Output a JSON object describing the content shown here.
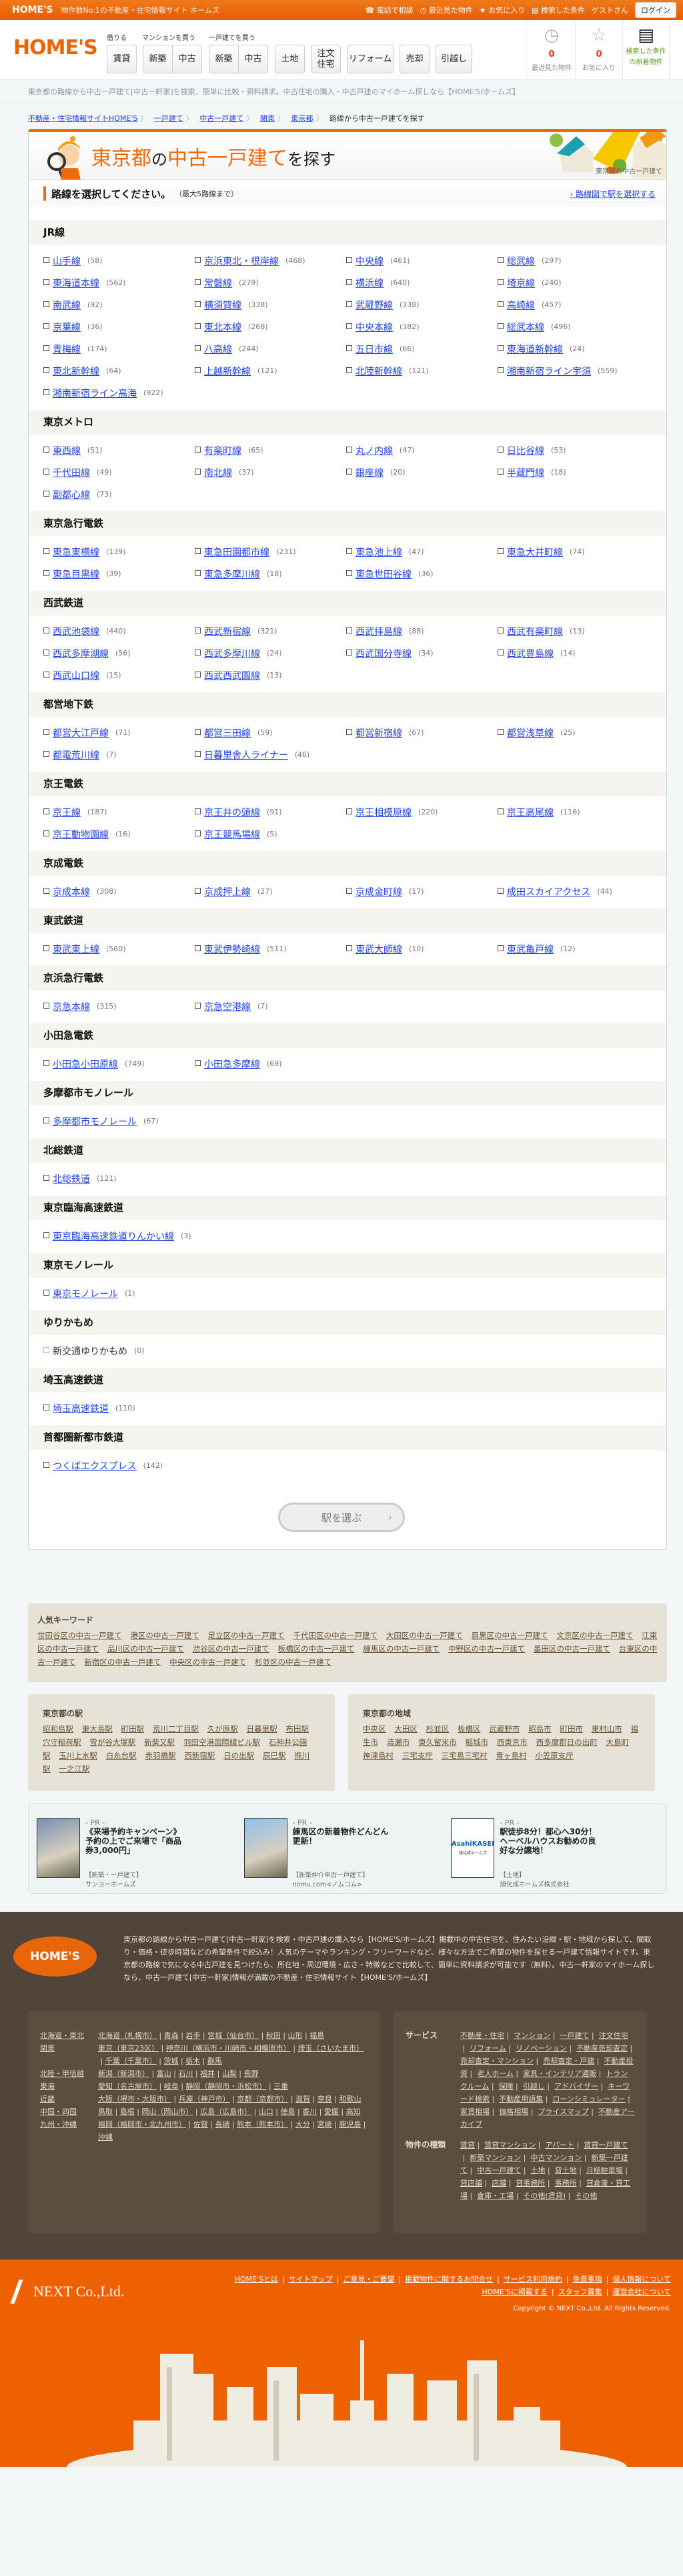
{
  "topbar": {
    "logo": "HOME'S",
    "tagline": "物件数No.1の不動産・住宅情報サイト ホームズ",
    "phone": "電話で相談",
    "recent": "最近見た物件",
    "favorites": "お気に入り",
    "searched": "検索した条件",
    "guest": "ゲストさん",
    "login": "ログイン"
  },
  "header": {
    "logo": "HOME'S",
    "nav_labels": {
      "rent": "借りる",
      "mansion": "マンションを買う",
      "house": "一戸建てを買う"
    },
    "buttons": [
      "賃貸",
      "新築",
      "中古",
      "新築",
      "中古",
      "土地",
      "注文住宅",
      "リフォーム",
      "売却",
      "引越し"
    ],
    "recent": {
      "count": "0",
      "label": "最近見た物件"
    },
    "favorites": {
      "count": "0",
      "label": "お気に入り"
    },
    "new_listings": {
      "label": "検索した条件の新着物件"
    }
  },
  "description": "東京都の路線から中古一戸建て[中古一軒家]を検索、簡単に比較・資料請求。中古住宅の購入・中古戸建のマイホーム探しなら【HOME'S/ホームズ】",
  "breadcrumb": [
    "不動産・住宅情報サイトHOME'S",
    "一戸建て",
    "中古一戸建て",
    "関東",
    "東京都"
  ],
  "breadcrumb_current": "路線から中古一戸建てを探す",
  "banner": {
    "pref": "東京都",
    "no": "の",
    "type": "中古一戸建て",
    "suffix": "を探す",
    "caption": "東京都の中古一戸建て"
  },
  "instruction": {
    "main": "路線を選択してください。",
    "sub": "（最大5路線まで）",
    "map_link": "路線図で駅を選択する"
  },
  "sections": [
    {
      "name": "JR線",
      "lines": [
        [
          "山手線",
          58
        ],
        [
          "京浜東北・根岸線",
          468
        ],
        [
          "中央線",
          461
        ],
        [
          "総武線",
          297
        ],
        [
          "東海道本線",
          562
        ],
        [
          "常磐線",
          279
        ],
        [
          "横浜線",
          640
        ],
        [
          "埼京線",
          240
        ],
        [
          "南武線",
          92
        ],
        [
          "横須賀線",
          338
        ],
        [
          "武蔵野線",
          338
        ],
        [
          "高崎線",
          457
        ],
        [
          "京葉線",
          36
        ],
        [
          "東北本線",
          268
        ],
        [
          "中央本線",
          382
        ],
        [
          "総武本線",
          496
        ],
        [
          "青梅線",
          174
        ],
        [
          "八高線",
          244
        ],
        [
          "五日市線",
          66
        ],
        [
          "東海道新幹線",
          24
        ],
        [
          "東北新幹線",
          64
        ],
        [
          "上越新幹線",
          121
        ],
        [
          "北陸新幹線",
          121
        ],
        [
          "湘南新宿ライン宇須",
          559
        ],
        [
          "湘南新宿ライン高海",
          922
        ]
      ]
    },
    {
      "name": "東京メトロ",
      "lines": [
        [
          "東西線",
          51
        ],
        [
          "有楽町線",
          65
        ],
        [
          "丸ノ内線",
          47
        ],
        [
          "日比谷線",
          53
        ],
        [
          "千代田線",
          49
        ],
        [
          "南北線",
          37
        ],
        [
          "銀座線",
          20
        ],
        [
          "半蔵門線",
          18
        ],
        [
          "副都心線",
          73
        ]
      ]
    },
    {
      "name": "東京急行電鉄",
      "lines": [
        [
          "東急東横線",
          139
        ],
        [
          "東急田園都市線",
          231
        ],
        [
          "東急池上線",
          47
        ],
        [
          "東急大井町線",
          74
        ],
        [
          "東急目黒線",
          39
        ],
        [
          "東急多摩川線",
          18
        ],
        [
          "東急世田谷線",
          36
        ]
      ]
    },
    {
      "name": "西武鉄道",
      "lines": [
        [
          "西武池袋線",
          440
        ],
        [
          "西武新宿線",
          321
        ],
        [
          "西武拝島線",
          88
        ],
        [
          "西武有楽町線",
          13
        ],
        [
          "西武多摩湖線",
          56
        ],
        [
          "西武多摩川線",
          24
        ],
        [
          "西武国分寺線",
          34
        ],
        [
          "西武豊島線",
          14
        ],
        [
          "西武山口線",
          15
        ],
        [
          "西武西武園線",
          13
        ]
      ]
    },
    {
      "name": "都営地下鉄",
      "lines": [
        [
          "都営大江戸線",
          71
        ],
        [
          "都営三田線",
          59
        ],
        [
          "都営新宿線",
          67
        ],
        [
          "都営浅草線",
          25
        ],
        [
          "都電荒川線",
          7
        ],
        [
          "日暮里舎人ライナー",
          46
        ]
      ]
    },
    {
      "name": "京王電鉄",
      "lines": [
        [
          "京王線",
          187
        ],
        [
          "京王井の頭線",
          91
        ],
        [
          "京王相模原線",
          220
        ],
        [
          "京王高尾線",
          116
        ],
        [
          "京王動物園線",
          16
        ],
        [
          "京王競馬場線",
          5
        ]
      ]
    },
    {
      "name": "京成電鉄",
      "lines": [
        [
          "京成本線",
          308
        ],
        [
          "京成押上線",
          27
        ],
        [
          "京成金町線",
          17
        ],
        [
          "成田スカイアクセス",
          44
        ]
      ]
    },
    {
      "name": "東武鉄道",
      "lines": [
        [
          "東武東上線",
          560
        ],
        [
          "東武伊勢崎線",
          511
        ],
        [
          "東武大師線",
          10
        ],
        [
          "東武亀戸線",
          12
        ]
      ]
    },
    {
      "name": "京浜急行電鉄",
      "lines": [
        [
          "京急本線",
          315
        ],
        [
          "京急空港線",
          7
        ]
      ]
    },
    {
      "name": "小田急電鉄",
      "lines": [
        [
          "小田急小田原線",
          749
        ],
        [
          "小田急多摩線",
          69
        ]
      ]
    },
    {
      "name": "多摩都市モノレール",
      "lines": [
        [
          "多摩都市モノレール",
          67
        ]
      ]
    },
    {
      "name": "北総鉄道",
      "lines": [
        [
          "北総鉄道",
          121
        ]
      ]
    },
    {
      "name": "東京臨海高速鉄道",
      "lines": [
        [
          "東京臨海高速鉄道りんかい線",
          3
        ]
      ]
    },
    {
      "name": "東京モノレール",
      "lines": [
        [
          "東京モノレール",
          1
        ]
      ]
    },
    {
      "name": "ゆりかもめ",
      "lines": [
        [
          "新交通ゆりかもめ",
          0,
          "disabled"
        ]
      ]
    },
    {
      "name": "埼玉高速鉄道",
      "lines": [
        [
          "埼玉高速鉄道",
          110
        ]
      ]
    },
    {
      "name": "首都圏新都市鉄道",
      "lines": [
        [
          "つくばエクスプレス",
          142
        ]
      ]
    }
  ],
  "select_button": "駅を選ぶ",
  "keywords": {
    "title": "人気キーワード",
    "links": [
      "世田谷区の中古一戸建て",
      "港区の中古一戸建て",
      "足立区の中古一戸建て",
      "千代田区の中古一戸建て",
      "大田区の中古一戸建て",
      "目黒区の中古一戸建て",
      "文京区の中古一戸建て",
      "江東区の中古一戸建て",
      "品川区の中古一戸建て",
      "渋谷区の中古一戸建て",
      "板橋区の中古一戸建て",
      "練馬区の中古一戸建て",
      "中野区の中古一戸建て",
      "墨田区の中古一戸建て",
      "台東区の中古一戸建て",
      "新宿区の中古一戸建て",
      "中央区の中古一戸建て",
      "杉並区の中古一戸建て"
    ]
  },
  "stations": {
    "title": "東京都の駅",
    "links": [
      "昭和島駅",
      "東大島駅",
      "町田駅",
      "荒川二丁目駅",
      "久が原駅",
      "日暮里駅",
      "布田駅",
      "穴守稲荷駅",
      "雪が谷大塚駅",
      "新柴又駅",
      "羽田空港国際線ビル駅",
      "石神井公園駅",
      "玉川上水駅",
      "白糸台駅",
      "赤羽橋駅",
      "西新宿駅",
      "日の出駅",
      "辰巳駅",
      "熊川駅",
      "一之江駅"
    ]
  },
  "areas": {
    "title": "東京都の地域",
    "links": [
      "中央区",
      "大田区",
      "杉並区",
      "板橋区",
      "武蔵野市",
      "昭島市",
      "町田市",
      "東村山市",
      "福生市",
      "清瀬市",
      "東久留米市",
      "稲城市",
      "西東京市",
      "西多摩郡日の出町",
      "大島町",
      "神津島村",
      "三宅支庁",
      "三宅島三宅村",
      "青ヶ島村",
      "小笠原支庁"
    ]
  },
  "pr": [
    {
      "tag": "- PR -",
      "headline": "《来場予約キャンペーン》予約の上でご来場で「商品券3,000円」",
      "category": "【新築・一戸建て】",
      "company": "サンヨーホームズ",
      "color": "#7a8fb0"
    },
    {
      "tag": "- PR -",
      "headline": "練馬区の新着物件どんどん更新！",
      "category": "【新築仲介中古一戸建て】",
      "company": "nomu.com<ノムコム>",
      "color": "#8fc0e8"
    },
    {
      "tag": "- PR -",
      "headline": "駅徒歩8分！都心へ30分！ヘーベルハウスお勧めの良好な分譲地！",
      "category": "【土地】",
      "company": "旭化成ホームズ株式会社",
      "logo_text": "AsahiKASEI",
      "logo_sub": "旭化成ホームズ",
      "color": "#1560b0"
    }
  ],
  "footer": {
    "logo": "HOME'S",
    "description": "東京都の路線から中古一戸建て[中古一軒家]を検索・中古戸建の購入なら【HOME'S/ホームズ】掲載中の中古住宅を、住みたい沿線・駅・地域から探して、間取り・価格・徒歩時間などの希望条件で絞込み！人気のテーマやランキング・フリーワードなど、様々な方法でご希望の物件を探せる一戸建て情報サイトです。東京都の路線で気になる中古戸建を見つけたら、所在地・周辺環境・広さ・特徴などで比較して、簡単に資料請求が可能です（無料）。中古一軒家のマイホーム探しなら、中古一戸建て[中古一軒家]情報が満載の不動産・住宅情報サイト【HOME'S/ホームズ】",
    "regions": [
      {
        "name": "北海道・東北",
        "links": [
          "北海道（札幌市）",
          "青森",
          "岩手",
          "宮城（仙台市）",
          "秋田",
          "山形",
          "福島"
        ]
      },
      {
        "name": "関東",
        "links": [
          "東京（東京23区）",
          "神奈川（横浜市・川崎市・相模原市）",
          "埼玉（さいたま市）",
          "千葉（千葉市）",
          "茨城",
          "栃木",
          "群馬"
        ]
      },
      {
        "name": "北陸・甲信越",
        "links": [
          "新潟（新潟市）",
          "富山",
          "石川",
          "福井",
          "山梨",
          "長野"
        ]
      },
      {
        "name": "東海",
        "links": [
          "愛知（名古屋市）",
          "岐阜",
          "静岡（静岡市・浜松市）",
          "三重"
        ]
      },
      {
        "name": "近畿",
        "links": [
          "大阪（堺市・大阪市）",
          "兵庫（神戸市）",
          "京都（京都市）",
          "滋賀",
          "奈良",
          "和歌山"
        ]
      },
      {
        "name": "中国・四国",
        "links": [
          "鳥取",
          "島根",
          "岡山（岡山市）",
          "広島（広島市）",
          "山口",
          "徳島",
          "香川",
          "愛媛",
          "高知"
        ]
      },
      {
        "name": "九州・沖縄",
        "links": [
          "福岡（福岡市・北九州市）",
          "佐賀",
          "長崎",
          "熊本（熊本市）",
          "大分",
          "宮崎",
          "鹿児島",
          "沖縄"
        ]
      }
    ],
    "services": {
      "name": "サービス",
      "links": [
        "不動産・住宅",
        "マンション",
        "一戸建て",
        "注文住宅",
        "リフォーム",
        "リノベーション",
        "不動産売却査定",
        "売却査定・マンション",
        "売却査定・戸建",
        "不動産投資",
        "老人ホーム",
        "家具・インテリア通販",
        "トランクルーム",
        "保険",
        "引越し",
        "アドバイザー",
        "キーワード検索",
        "不動産用語集",
        "ローンシミュレーター",
        "家賃相場",
        "価格相場",
        "プライスマップ",
        "不動産アーカイブ"
      ]
    },
    "types": {
      "name": "物件の種類",
      "links": [
        "賃貸",
        "賃貸マンション",
        "アパート",
        "賃貸一戸建て",
        "新築マンション",
        "中古マンション",
        "新築一戸建て",
        "中古一戸建て",
        "土地",
        "貸土地",
        "月極駐車場",
        "貸店舗",
        "店舗",
        "貸事務所",
        "事務所",
        "貸倉庫・貸工場",
        "倉庫・工場",
        "その他(賃貸)",
        "その他"
      ]
    },
    "company": "NEXT Co.,Ltd.",
    "bottom_links": [
      "HOME'Sとは",
      "サイトマップ",
      "ご意見・ご要望",
      "掲載物件に関するお問合せ",
      "サービス利用規約",
      "免責事項",
      "個人情報について",
      "HOME'Sに掲載する",
      "スタッフ募集",
      "運営会社について"
    ],
    "copyright": "Copyright © NEXT Co.,Ltd. All Rights Reserved."
  }
}
